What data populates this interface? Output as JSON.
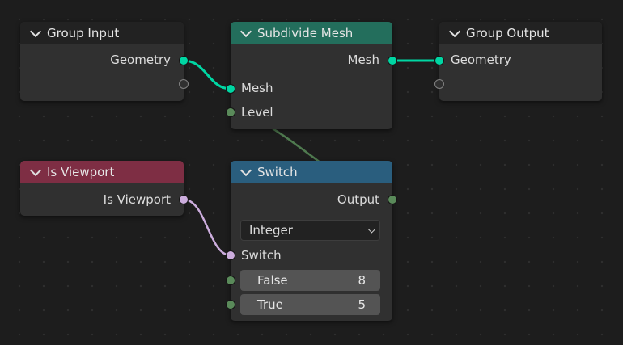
{
  "nodes": {
    "group_input": {
      "title": "Group Input",
      "outputs": [
        "Geometry"
      ]
    },
    "subdivide_mesh": {
      "title": "Subdivide Mesh",
      "outputs": [
        "Mesh"
      ],
      "inputs": [
        "Mesh",
        "Level"
      ]
    },
    "group_output": {
      "title": "Group Output",
      "inputs": [
        "Geometry"
      ]
    },
    "is_viewport": {
      "title": "Is Viewport",
      "outputs": [
        "Is Viewport"
      ]
    },
    "switch": {
      "title": "Switch",
      "outputs": [
        "Output"
      ],
      "type_value": "Integer",
      "inputs": [
        "Switch"
      ],
      "fields": [
        {
          "label": "False",
          "value": "8"
        },
        {
          "label": "True",
          "value": "5"
        }
      ]
    }
  },
  "colors": {
    "background": "#1d1d1d",
    "node_body": "#303030",
    "geometry_socket": "#00d6a3",
    "integer_socket": "#5a8a5a",
    "boolean_socket": "#ccaddd",
    "teal_header": "#236e5c",
    "red_header": "#7e2e44",
    "blue_header": "#2a5e7e"
  },
  "icons": {
    "collapse": "chevron-down-icon",
    "dropdown": "chevron-down-icon"
  }
}
